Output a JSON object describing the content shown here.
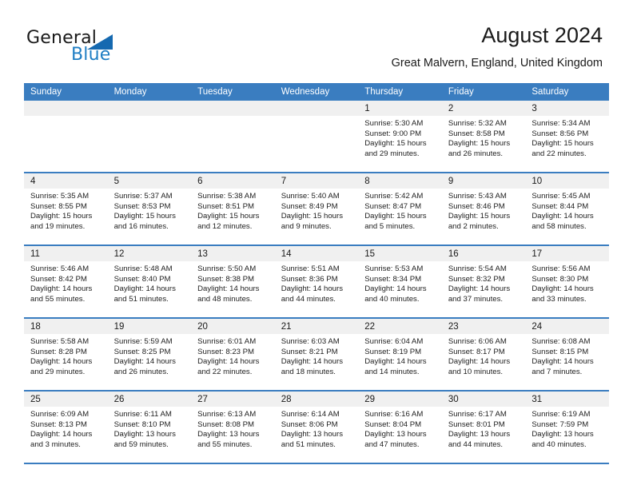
{
  "brand": {
    "name_top": "General",
    "name_bottom": "Blue",
    "accent_color": "#1569b0",
    "text_color": "#1a1a1a"
  },
  "header": {
    "title": "August 2024",
    "subtitle": "Great Malvern, England, United Kingdom",
    "header_bg_color": "#3a7dc0"
  },
  "weekdays": [
    "Sunday",
    "Monday",
    "Tuesday",
    "Wednesday",
    "Thursday",
    "Friday",
    "Saturday"
  ],
  "weeks": [
    [
      {
        "day": "",
        "lines": []
      },
      {
        "day": "",
        "lines": []
      },
      {
        "day": "",
        "lines": []
      },
      {
        "day": "",
        "lines": []
      },
      {
        "day": "1",
        "lines": [
          "Sunrise: 5:30 AM",
          "Sunset: 9:00 PM",
          "Daylight: 15 hours",
          "and 29 minutes."
        ]
      },
      {
        "day": "2",
        "lines": [
          "Sunrise: 5:32 AM",
          "Sunset: 8:58 PM",
          "Daylight: 15 hours",
          "and 26 minutes."
        ]
      },
      {
        "day": "3",
        "lines": [
          "Sunrise: 5:34 AM",
          "Sunset: 8:56 PM",
          "Daylight: 15 hours",
          "and 22 minutes."
        ]
      }
    ],
    [
      {
        "day": "4",
        "lines": [
          "Sunrise: 5:35 AM",
          "Sunset: 8:55 PM",
          "Daylight: 15 hours",
          "and 19 minutes."
        ]
      },
      {
        "day": "5",
        "lines": [
          "Sunrise: 5:37 AM",
          "Sunset: 8:53 PM",
          "Daylight: 15 hours",
          "and 16 minutes."
        ]
      },
      {
        "day": "6",
        "lines": [
          "Sunrise: 5:38 AM",
          "Sunset: 8:51 PM",
          "Daylight: 15 hours",
          "and 12 minutes."
        ]
      },
      {
        "day": "7",
        "lines": [
          "Sunrise: 5:40 AM",
          "Sunset: 8:49 PM",
          "Daylight: 15 hours",
          "and 9 minutes."
        ]
      },
      {
        "day": "8",
        "lines": [
          "Sunrise: 5:42 AM",
          "Sunset: 8:47 PM",
          "Daylight: 15 hours",
          "and 5 minutes."
        ]
      },
      {
        "day": "9",
        "lines": [
          "Sunrise: 5:43 AM",
          "Sunset: 8:46 PM",
          "Daylight: 15 hours",
          "and 2 minutes."
        ]
      },
      {
        "day": "10",
        "lines": [
          "Sunrise: 5:45 AM",
          "Sunset: 8:44 PM",
          "Daylight: 14 hours",
          "and 58 minutes."
        ]
      }
    ],
    [
      {
        "day": "11",
        "lines": [
          "Sunrise: 5:46 AM",
          "Sunset: 8:42 PM",
          "Daylight: 14 hours",
          "and 55 minutes."
        ]
      },
      {
        "day": "12",
        "lines": [
          "Sunrise: 5:48 AM",
          "Sunset: 8:40 PM",
          "Daylight: 14 hours",
          "and 51 minutes."
        ]
      },
      {
        "day": "13",
        "lines": [
          "Sunrise: 5:50 AM",
          "Sunset: 8:38 PM",
          "Daylight: 14 hours",
          "and 48 minutes."
        ]
      },
      {
        "day": "14",
        "lines": [
          "Sunrise: 5:51 AM",
          "Sunset: 8:36 PM",
          "Daylight: 14 hours",
          "and 44 minutes."
        ]
      },
      {
        "day": "15",
        "lines": [
          "Sunrise: 5:53 AM",
          "Sunset: 8:34 PM",
          "Daylight: 14 hours",
          "and 40 minutes."
        ]
      },
      {
        "day": "16",
        "lines": [
          "Sunrise: 5:54 AM",
          "Sunset: 8:32 PM",
          "Daylight: 14 hours",
          "and 37 minutes."
        ]
      },
      {
        "day": "17",
        "lines": [
          "Sunrise: 5:56 AM",
          "Sunset: 8:30 PM",
          "Daylight: 14 hours",
          "and 33 minutes."
        ]
      }
    ],
    [
      {
        "day": "18",
        "lines": [
          "Sunrise: 5:58 AM",
          "Sunset: 8:28 PM",
          "Daylight: 14 hours",
          "and 29 minutes."
        ]
      },
      {
        "day": "19",
        "lines": [
          "Sunrise: 5:59 AM",
          "Sunset: 8:25 PM",
          "Daylight: 14 hours",
          "and 26 minutes."
        ]
      },
      {
        "day": "20",
        "lines": [
          "Sunrise: 6:01 AM",
          "Sunset: 8:23 PM",
          "Daylight: 14 hours",
          "and 22 minutes."
        ]
      },
      {
        "day": "21",
        "lines": [
          "Sunrise: 6:03 AM",
          "Sunset: 8:21 PM",
          "Daylight: 14 hours",
          "and 18 minutes."
        ]
      },
      {
        "day": "22",
        "lines": [
          "Sunrise: 6:04 AM",
          "Sunset: 8:19 PM",
          "Daylight: 14 hours",
          "and 14 minutes."
        ]
      },
      {
        "day": "23",
        "lines": [
          "Sunrise: 6:06 AM",
          "Sunset: 8:17 PM",
          "Daylight: 14 hours",
          "and 10 minutes."
        ]
      },
      {
        "day": "24",
        "lines": [
          "Sunrise: 6:08 AM",
          "Sunset: 8:15 PM",
          "Daylight: 14 hours",
          "and 7 minutes."
        ]
      }
    ],
    [
      {
        "day": "25",
        "lines": [
          "Sunrise: 6:09 AM",
          "Sunset: 8:13 PM",
          "Daylight: 14 hours",
          "and 3 minutes."
        ]
      },
      {
        "day": "26",
        "lines": [
          "Sunrise: 6:11 AM",
          "Sunset: 8:10 PM",
          "Daylight: 13 hours",
          "and 59 minutes."
        ]
      },
      {
        "day": "27",
        "lines": [
          "Sunrise: 6:13 AM",
          "Sunset: 8:08 PM",
          "Daylight: 13 hours",
          "and 55 minutes."
        ]
      },
      {
        "day": "28",
        "lines": [
          "Sunrise: 6:14 AM",
          "Sunset: 8:06 PM",
          "Daylight: 13 hours",
          "and 51 minutes."
        ]
      },
      {
        "day": "29",
        "lines": [
          "Sunrise: 6:16 AM",
          "Sunset: 8:04 PM",
          "Daylight: 13 hours",
          "and 47 minutes."
        ]
      },
      {
        "day": "30",
        "lines": [
          "Sunrise: 6:17 AM",
          "Sunset: 8:01 PM",
          "Daylight: 13 hours",
          "and 44 minutes."
        ]
      },
      {
        "day": "31",
        "lines": [
          "Sunrise: 6:19 AM",
          "Sunset: 7:59 PM",
          "Daylight: 13 hours",
          "and 40 minutes."
        ]
      }
    ]
  ]
}
